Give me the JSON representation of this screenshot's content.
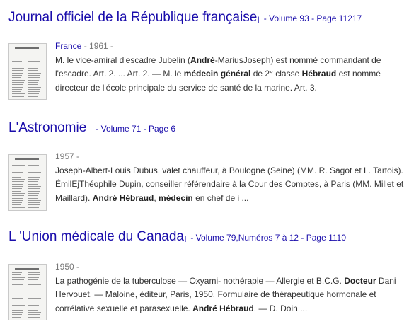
{
  "results": [
    {
      "title": "Journal officiel de la République française",
      "meta": "- Volume 93 - Page 11217",
      "publisher": "France",
      "year": " - 1961 -",
      "snippet": [
        {
          "t": "M. le vice-amiral d'escadre Jubelin ("
        },
        {
          "t": "André",
          "b": true
        },
        {
          "t": "-MariusJoseph) est nommé commandant de l'escadre. Art. 2. ... Art. 2. — M. le "
        },
        {
          "t": "médecin général",
          "b": true
        },
        {
          "t": " de 2° classe "
        },
        {
          "t": "Hébraud",
          "b": true
        },
        {
          "t": " est nommé directeur de l'école principale du service de santé de la marine. Art. 3."
        }
      ]
    },
    {
      "title": "L'Astronomie",
      "meta": "- Volume 71 - Page 6",
      "year": "1957 -",
      "snippet": [
        {
          "t": "Joseph-Albert-Louis Dubus, valet chauffeur, à Boulogne (Seine) (MM. R. Sagot et L. Tartois). ÉmilEjThéophile Dupin, conseiller référendaire à la Cour des Comptes, à Paris (MM. Millet et Maillard). "
        },
        {
          "t": "André Hébraud",
          "b": true
        },
        {
          "t": ", "
        },
        {
          "t": "médecin",
          "b": true
        },
        {
          "t": " en chef de i ..."
        }
      ]
    },
    {
      "title": "L 'Union médicale du Canada",
      "meta": "- Volume 79,Numéros 7 à 12 - Page 1110",
      "year": "1950 -",
      "snippet": [
        {
          "t": "La pathogénie de la tuberculose — Oxyami- nothérapie — Allergie et B.C.G. "
        },
        {
          "t": "Docteur",
          "b": true
        },
        {
          "t": " Dani Hervouet. — Maloine, éditeur, Paris, 1950. Formulaire de thérapeutique hormonale et corrélative sexuelle et parasexuelle. "
        },
        {
          "t": "André Hébraud",
          "b": true
        },
        {
          "t": ". — D. Doin ..."
        }
      ]
    }
  ]
}
